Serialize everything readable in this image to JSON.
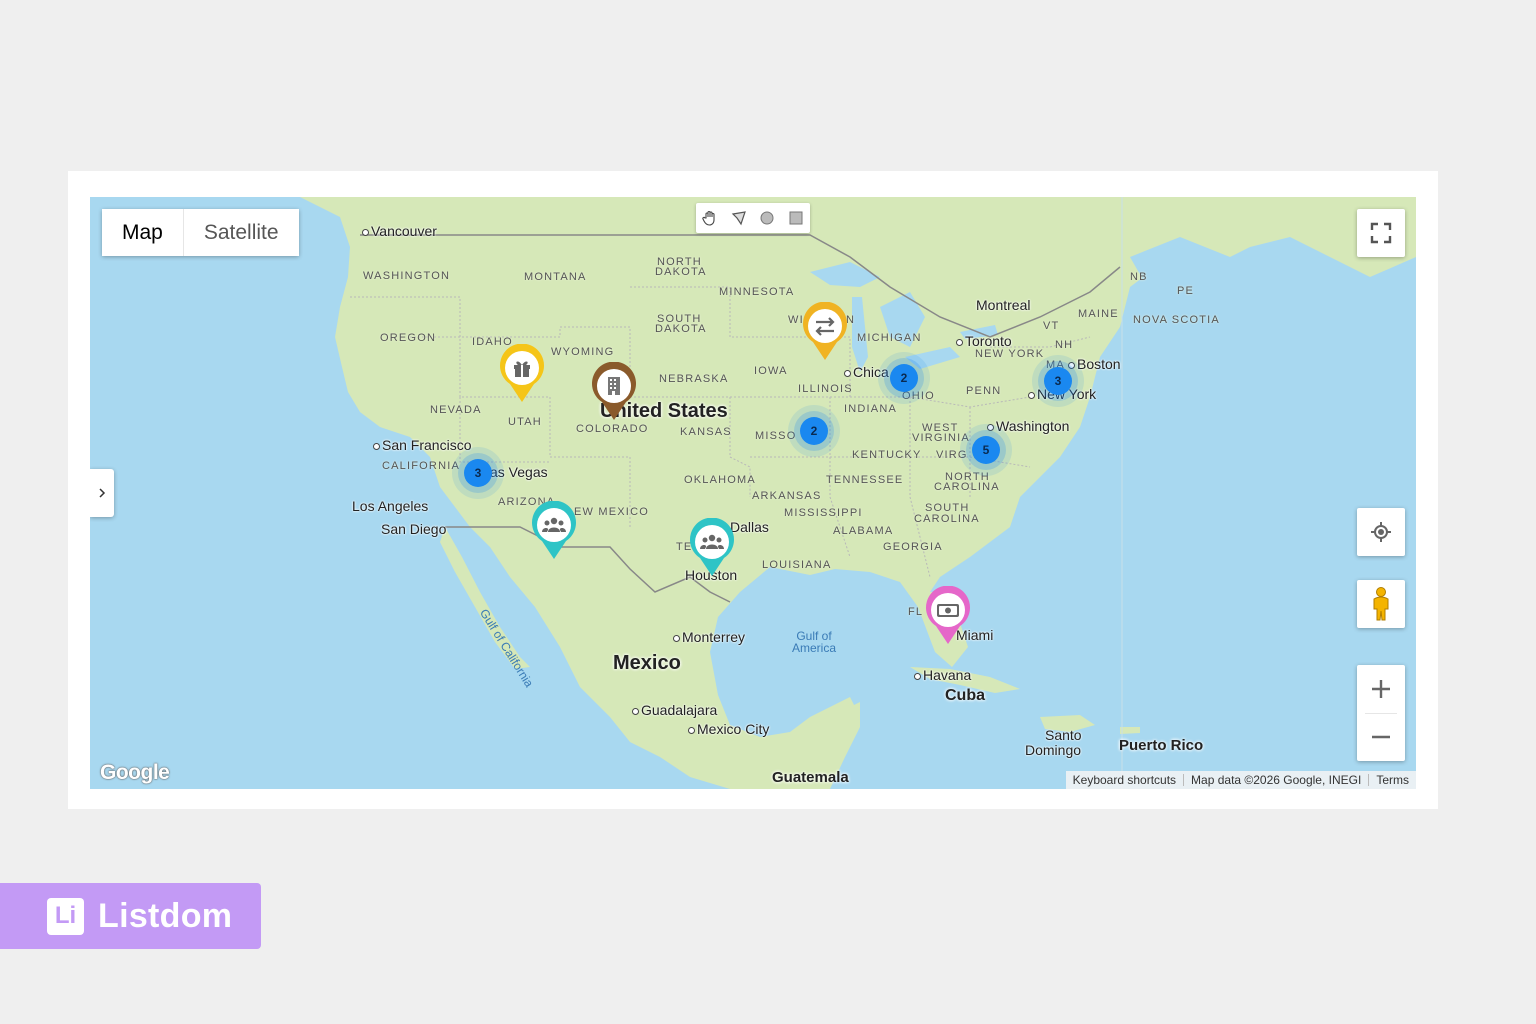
{
  "map_type": {
    "map": "Map",
    "satellite": "Satellite"
  },
  "countries": {
    "usa": "United States",
    "mexico": "Mexico",
    "cuba": "Cuba",
    "guatemala": "Guatemala",
    "puerto_rico": "Puerto Rico"
  },
  "cities": {
    "vancouver": "Vancouver",
    "san_francisco": "San Francisco",
    "los_angeles": "Los Angeles",
    "san_diego": "San Diego",
    "las_vegas": "as Vegas",
    "dallas": "Dallas",
    "houston": "Houston",
    "chicago": "Chica",
    "toronto": "Toronto",
    "montreal": "Montreal",
    "boston": "Boston",
    "new_york": "New York",
    "washington": "Washington",
    "miami": "Miami",
    "havana": "Havana",
    "monterrey": "Monterrey",
    "guadalajara": "Guadalajara",
    "mexico_city": "Mexico City",
    "santo_domingo_1": "Santo",
    "santo_domingo_2": "Domingo"
  },
  "states": {
    "washington": "WASHINGTON",
    "oregon": "OREGON",
    "california": "CALIFORNIA",
    "nevada": "NEVADA",
    "idaho": "IDAHO",
    "montana": "MONTANA",
    "wyoming": "WYOMING",
    "utah": "UTAH",
    "arizona": "ARIZONA",
    "colorado": "COLORADO",
    "new_mexico": "EW MEXICO",
    "north_dakota_1": "NORTH",
    "north_dakota_2": "DAKOTA",
    "south_dakota_1": "SOUTH",
    "south_dakota_2": "DAKOTA",
    "nebraska": "NEBRASKA",
    "kansas": "KANSAS",
    "oklahoma": "OKLAHOMA",
    "texas": "TE",
    "minnesota": "MINNESOTA",
    "iowa": "IOWA",
    "missouri": "MISSO",
    "arkansas": "ARKANSAS",
    "louisiana": "LOUISIANA",
    "wisconsin": "WI",
    "wisconsin2": "N",
    "illinois": "ILLINOIS",
    "michigan": "MICHIGAN",
    "indiana": "INDIANA",
    "ohio": "OHIO",
    "kentucky": "KENTUCKY",
    "tennessee": "TENNESSEE",
    "mississippi": "MISSISSIPPI",
    "alabama": "ALABAMA",
    "georgia": "GEORGIA",
    "florida": "FL",
    "south_carolina_1": "SOUTH",
    "south_carolina_2": "CAROLINA",
    "north_carolina_1": "NORTH",
    "north_carolina_2": "CAROLINA",
    "virginia": "VIRG",
    "west_virginia_1": "WEST",
    "west_virginia_2": "VIRGINIA",
    "penn": "PENN",
    "new_york": "NEW YORK",
    "vt": "VT",
    "nh": "NH",
    "maine": "MAINE",
    "ma": "MA",
    "nova_scotia": "NOVA SCOTIA",
    "nb": "NB",
    "pe": "PE"
  },
  "water": {
    "gulf_of_america_1": "Gulf of",
    "gulf_of_america_2": "America",
    "gulf_of_california": "Gulf of California"
  },
  "clusters": [
    {
      "id": "las-vegas",
      "count": "3"
    },
    {
      "id": "missouri",
      "count": "2"
    },
    {
      "id": "chicago",
      "count": "2"
    },
    {
      "id": "new-york",
      "count": "3"
    },
    {
      "id": "washington",
      "count": "5"
    }
  ],
  "pins": [
    {
      "id": "utah-gift",
      "icon": "gift-icon",
      "color": "#f5c518"
    },
    {
      "id": "colorado-building",
      "icon": "building-icon",
      "color": "#8a5a2b"
    },
    {
      "id": "wisconsin-exchange",
      "icon": "exchange-icon",
      "color": "#f0b323"
    },
    {
      "id": "arizona-group",
      "icon": "group-icon",
      "color": "#2ec4c6"
    },
    {
      "id": "texas-group",
      "icon": "group-icon",
      "color": "#2ec4c6"
    },
    {
      "id": "florida-money",
      "icon": "money-icon",
      "color": "#e567c9"
    }
  ],
  "attribution": {
    "shortcuts": "Keyboard shortcuts",
    "data": "Map data ©2026 Google, INEGI",
    "terms": "Terms"
  },
  "google_logo": "Google",
  "brand": {
    "mark": "Li",
    "name": "Listdom"
  },
  "colors": {
    "land": "#d6e8b8",
    "water": "#a8d8f0",
    "cluster": "#1a88f0",
    "brand": "#c39af5"
  }
}
